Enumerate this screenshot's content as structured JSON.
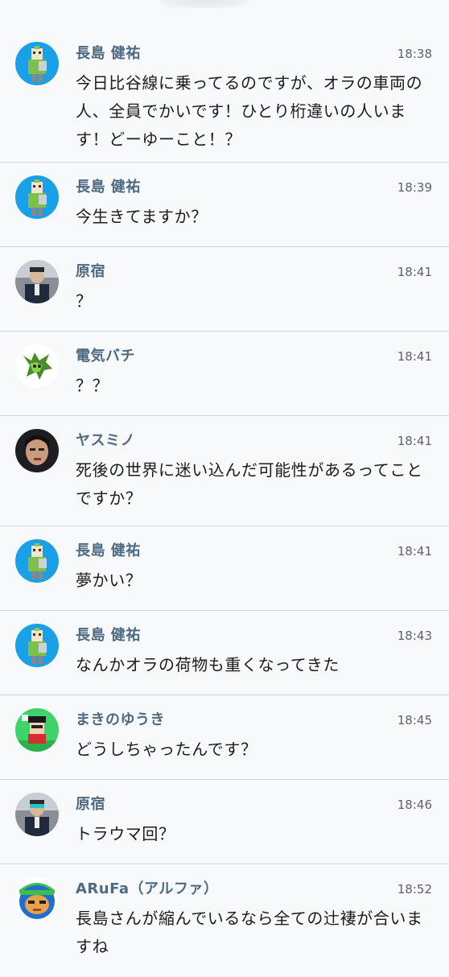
{
  "messages": [
    {
      "name": "長島 健祐",
      "time": "18:38",
      "text": "今日比谷線に乗ってるのですが、オラの車両の人、全員でかいです！ひとり桁違いの人います！どーゆーこと！？",
      "avatar": "pixel-boy-avatar"
    },
    {
      "name": "長島 健祐",
      "time": "18:39",
      "text": "今生きてますか？",
      "avatar": "pixel-boy-avatar"
    },
    {
      "name": "原宿",
      "time": "18:41",
      "text": "？",
      "avatar": "photo-police-avatar"
    },
    {
      "name": "電気バチ",
      "time": "18:41",
      "text": "？？",
      "avatar": "green-creature-avatar"
    },
    {
      "name": "ヤスミノ",
      "time": "18:41",
      "text": "死後の世界に迷い込んだ可能性があるってことですか？",
      "avatar": "photo-man-avatar"
    },
    {
      "name": "長島 健祐",
      "time": "18:41",
      "text": "夢かい？",
      "avatar": "pixel-boy-avatar"
    },
    {
      "name": "長島 健祐",
      "time": "18:43",
      "text": "なんかオラの荷物も重くなってきた",
      "avatar": "pixel-boy-avatar"
    },
    {
      "name": "まきのゆうき",
      "time": "18:45",
      "text": "どうしちゃったんです？",
      "avatar": "pixel-green-avatar"
    },
    {
      "name": "原宿",
      "time": "18:46",
      "text": "トラウマ回？",
      "avatar": "photo-police-avatar"
    },
    {
      "name": "ARuFa（アルファ）",
      "time": "18:52",
      "text": "長島さんが縮んでいるなら全ての辻褄が合いますね",
      "avatar": "blue-cap-avatar"
    }
  ]
}
